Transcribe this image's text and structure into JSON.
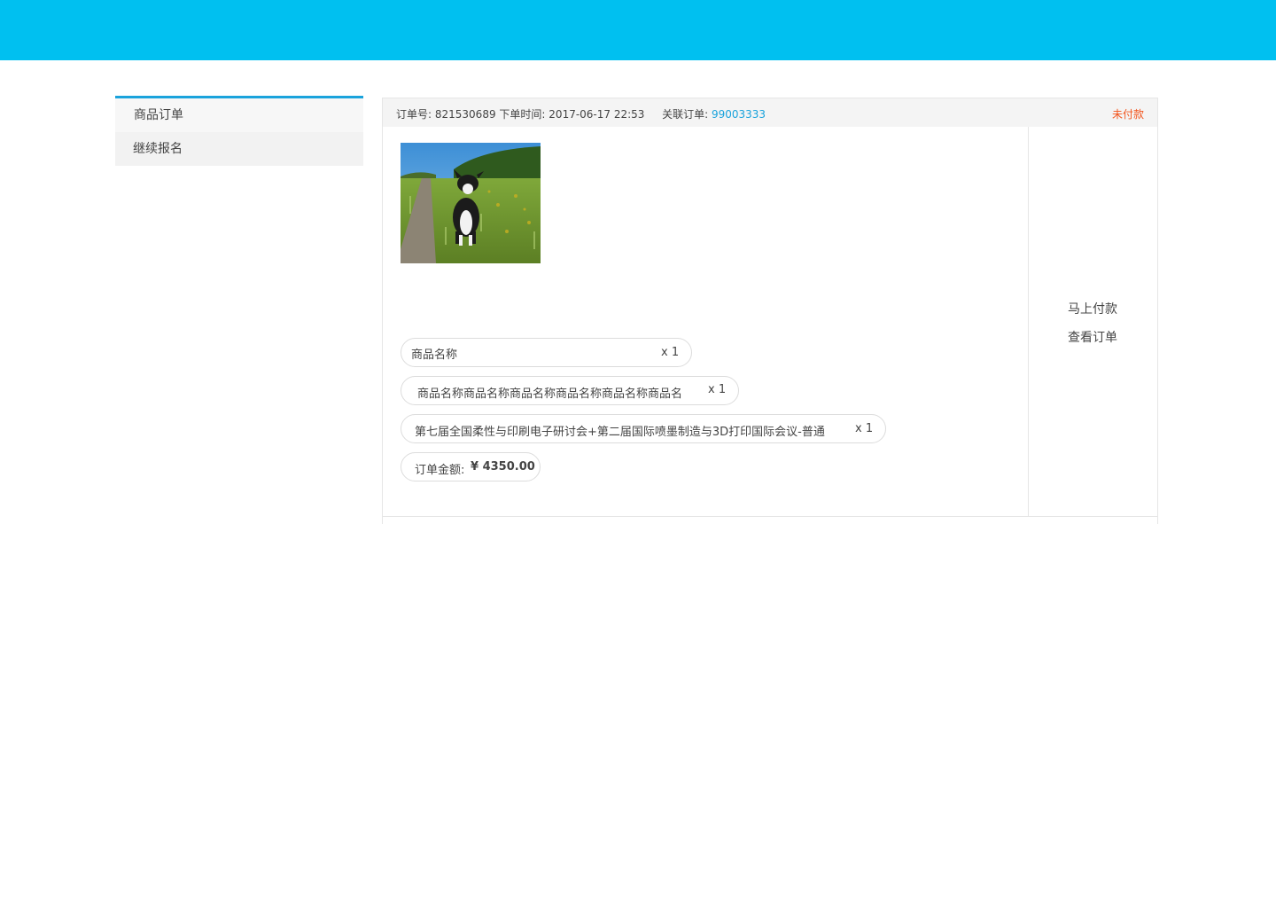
{
  "sidebar": {
    "items": [
      {
        "label": "商品订单"
      },
      {
        "label": "继续报名"
      }
    ]
  },
  "order": {
    "no_label": "订单号:",
    "no_value": "821530689",
    "time_label": "下单时间:",
    "time_value": "2017-06-17 22:53",
    "related_label": "关联订单:",
    "related_value": "99003333",
    "status": "未付款",
    "items": [
      {
        "name": "商品名称",
        "qty": "x 1"
      },
      {
        "name": "商品名称商品名称商品名称商品名称商品名称商品名",
        "qty": "x 1"
      },
      {
        "name": "第七届全国柔性与印刷电子研讨会+第二届国际喷墨制造与3D打印国际会议-普通",
        "qty": "x 1"
      }
    ],
    "total_label": "订单金额:",
    "total_value": "¥ 4350.00"
  },
  "actions": {
    "pay_now": "马上付款",
    "view_order": "查看订单"
  },
  "colors": {
    "topbar": "#00c0f0",
    "accent": "#1aa3dc",
    "status_unpaid": "#f2541c"
  }
}
